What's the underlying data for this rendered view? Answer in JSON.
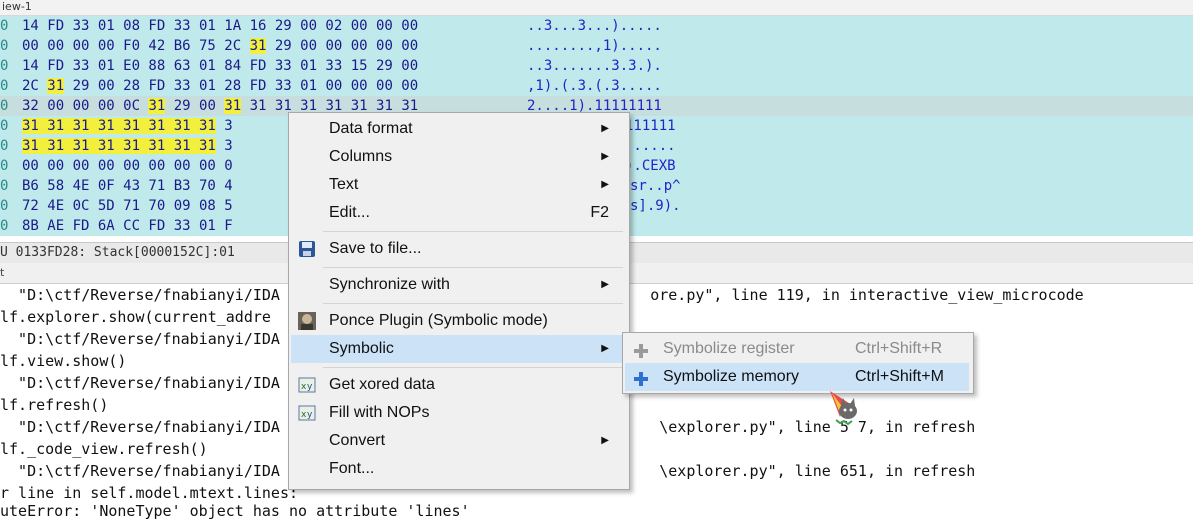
{
  "window": {
    "title": "iew-1"
  },
  "hex": {
    "rows": [
      {
        "addr": "0",
        "bytes": "14 FD 33 01 08 FD 33 01  1A 16 29 00 02 00 00 00",
        "ascii": "..3...3...)....."
      },
      {
        "addr": "0",
        "bytes": "00 00 00 00 F0 42 B6 75  2C 31 29 00 00 00 00 00",
        "ascii": "........,1)....."
      },
      {
        "addr": "0",
        "bytes": "14 FD 33 01 E0 88 63 01  84 FD 33 01 33 15 29 00",
        "ascii": "..3.......3.3.)."
      },
      {
        "addr": "0",
        "bytes": "2C 31 29 00 28 FD 33 01  28 FD 33 01 00 00 00 00",
        "ascii": ",1).(.3.(.3....."
      },
      {
        "addr": "0",
        "bytes": "32 00 00 00 0C 31 29 00  31 31 31 31 31 31 31 31",
        "ascii": "2....1).11111111"
      },
      {
        "addr": "0",
        "bytes": "31 31 31 31 31 31 31 31  3",
        "ascii": "111111"
      },
      {
        "addr": "0",
        "bytes": "31 31 31 31 31 31 31 31  3",
        "ascii": "......"
      },
      {
        "addr": "0",
        "bytes": "00 00 00 00 00 00 00 00  0",
        "ascii": ").CEXB"
      },
      {
        "addr": "0",
        "bytes": "B6 58 4E 0F 43 71 B3 70  4",
        "ascii": "sr..p^"
      },
      {
        "addr": "0",
        "bytes": "72 4E 0C 5D 71 70 09 08  5",
        "ascii": "s].9)."
      },
      {
        "addr": "0",
        "bytes": "8B AE FD 6A CC FD 33 01  F",
        "ascii": ""
      }
    ],
    "status": "U 0133FD28: Stack[0000152C]:01"
  },
  "output": {
    "tab_label": "t",
    "lines": [
      "  \"D:\\ctf/Reverse/fnabianyi/IDA                                         ore.py\", line 119, in interactive_view_microcode",
      "lf.explorer.show(current_addre",
      "  \"D:\\ctf/Reverse/fnabianyi/IDA",
      "lf.view.show()",
      "  \"D:\\ctf/Reverse/fnabianyi/IDA",
      "lf.refresh()",
      "  \"D:\\ctf/Reverse/fnabianyi/IDA                                          \\explorer.py\", line 5 7, in refresh",
      "lf._code_view.refresh()",
      "  \"D:\\ctf/Reverse/fnabianyi/IDA                                          \\explorer.py\", line 651, in refresh",
      "r line in self.model.mtext.lines:",
      "uteError: 'NoneType' object has no attribute 'lines'"
    ]
  },
  "menu": {
    "data_format": "Data format",
    "columns": "Columns",
    "text": "Text",
    "edit": "Edit...",
    "edit_shortcut": "F2",
    "save": "Save to file...",
    "synchronize": "Synchronize with",
    "ponce": "Ponce Plugin (Symbolic mode)",
    "symbolic": "Symbolic",
    "xored": "Get xored data",
    "fill_nops": "Fill with NOPs",
    "convert": "Convert",
    "font": "Font...",
    "submenu_arrow": "▶"
  },
  "submenu": {
    "symbolize_register": "Symbolize register",
    "symbolize_register_shortcut": "Ctrl+Shift+R",
    "symbolize_memory": "Symbolize memory",
    "symbolize_memory_shortcut": "Ctrl+Shift+M"
  },
  "colors": {
    "hex_bg": "#bfe9ea",
    "highlight": "#f2f03c",
    "menu_bg": "#f0f0f0",
    "menu_active": "#cce3f7"
  }
}
